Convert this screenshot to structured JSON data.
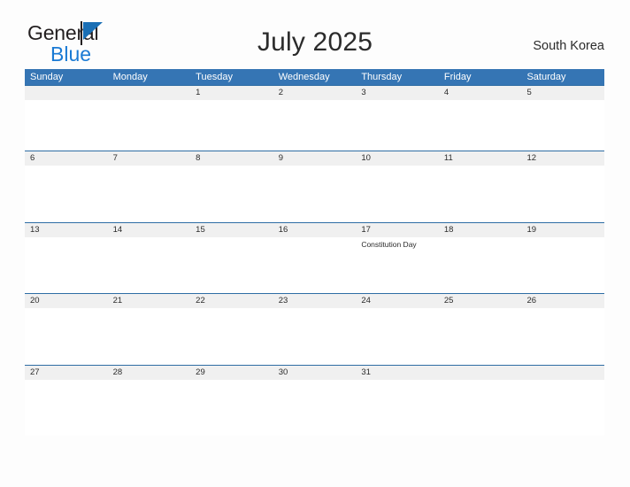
{
  "brand": {
    "name_line1": "General",
    "name_line2": "Blue",
    "flag_icon": "blue-triangle-flag-icon",
    "color_dark": "#231f20",
    "color_blue": "#1a7ad4"
  },
  "header": {
    "title": "July 2025",
    "region": "South Korea"
  },
  "colors": {
    "weekday_header_bg": "#3575b4",
    "week_top_border": "#2e6da4",
    "date_band_bg": "#f0f0f0",
    "page_bg": "#fdfdfd",
    "text": "#2b2b2b"
  },
  "calendar": {
    "month": "July",
    "year": "2025",
    "weekdays": [
      "Sunday",
      "Monday",
      "Tuesday",
      "Wednesday",
      "Thursday",
      "Friday",
      "Saturday"
    ],
    "weeks": [
      {
        "days": [
          {
            "num": "",
            "events": []
          },
          {
            "num": "",
            "events": []
          },
          {
            "num": "1",
            "events": []
          },
          {
            "num": "2",
            "events": []
          },
          {
            "num": "3",
            "events": []
          },
          {
            "num": "4",
            "events": []
          },
          {
            "num": "5",
            "events": []
          }
        ]
      },
      {
        "days": [
          {
            "num": "6",
            "events": []
          },
          {
            "num": "7",
            "events": []
          },
          {
            "num": "8",
            "events": []
          },
          {
            "num": "9",
            "events": []
          },
          {
            "num": "10",
            "events": []
          },
          {
            "num": "11",
            "events": []
          },
          {
            "num": "12",
            "events": []
          }
        ]
      },
      {
        "days": [
          {
            "num": "13",
            "events": []
          },
          {
            "num": "14",
            "events": []
          },
          {
            "num": "15",
            "events": []
          },
          {
            "num": "16",
            "events": []
          },
          {
            "num": "17",
            "events": [
              "Constitution Day"
            ]
          },
          {
            "num": "18",
            "events": []
          },
          {
            "num": "19",
            "events": []
          }
        ]
      },
      {
        "days": [
          {
            "num": "20",
            "events": []
          },
          {
            "num": "21",
            "events": []
          },
          {
            "num": "22",
            "events": []
          },
          {
            "num": "23",
            "events": []
          },
          {
            "num": "24",
            "events": []
          },
          {
            "num": "25",
            "events": []
          },
          {
            "num": "26",
            "events": []
          }
        ]
      },
      {
        "days": [
          {
            "num": "27",
            "events": []
          },
          {
            "num": "28",
            "events": []
          },
          {
            "num": "29",
            "events": []
          },
          {
            "num": "30",
            "events": []
          },
          {
            "num": "31",
            "events": []
          },
          {
            "num": "",
            "events": []
          },
          {
            "num": "",
            "events": []
          }
        ]
      }
    ]
  }
}
